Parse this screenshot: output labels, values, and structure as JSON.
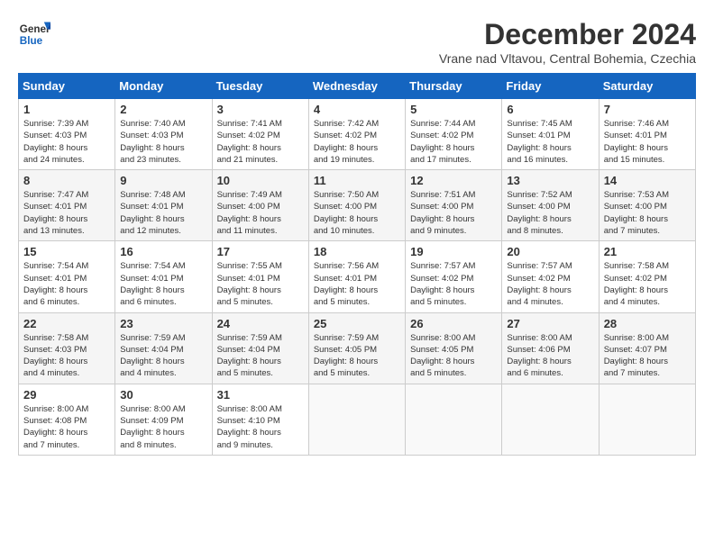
{
  "logo": {
    "line1": "General",
    "line2": "Blue"
  },
  "title": "December 2024",
  "subtitle": "Vrane nad Vltavou, Central Bohemia, Czechia",
  "days_of_week": [
    "Sunday",
    "Monday",
    "Tuesday",
    "Wednesday",
    "Thursday",
    "Friday",
    "Saturday"
  ],
  "weeks": [
    [
      {
        "day": "1",
        "info": "Sunrise: 7:39 AM\nSunset: 4:03 PM\nDaylight: 8 hours\nand 24 minutes."
      },
      {
        "day": "2",
        "info": "Sunrise: 7:40 AM\nSunset: 4:03 PM\nDaylight: 8 hours\nand 23 minutes."
      },
      {
        "day": "3",
        "info": "Sunrise: 7:41 AM\nSunset: 4:02 PM\nDaylight: 8 hours\nand 21 minutes."
      },
      {
        "day": "4",
        "info": "Sunrise: 7:42 AM\nSunset: 4:02 PM\nDaylight: 8 hours\nand 19 minutes."
      },
      {
        "day": "5",
        "info": "Sunrise: 7:44 AM\nSunset: 4:02 PM\nDaylight: 8 hours\nand 17 minutes."
      },
      {
        "day": "6",
        "info": "Sunrise: 7:45 AM\nSunset: 4:01 PM\nDaylight: 8 hours\nand 16 minutes."
      },
      {
        "day": "7",
        "info": "Sunrise: 7:46 AM\nSunset: 4:01 PM\nDaylight: 8 hours\nand 15 minutes."
      }
    ],
    [
      {
        "day": "8",
        "info": "Sunrise: 7:47 AM\nSunset: 4:01 PM\nDaylight: 8 hours\nand 13 minutes."
      },
      {
        "day": "9",
        "info": "Sunrise: 7:48 AM\nSunset: 4:01 PM\nDaylight: 8 hours\nand 12 minutes."
      },
      {
        "day": "10",
        "info": "Sunrise: 7:49 AM\nSunset: 4:00 PM\nDaylight: 8 hours\nand 11 minutes."
      },
      {
        "day": "11",
        "info": "Sunrise: 7:50 AM\nSunset: 4:00 PM\nDaylight: 8 hours\nand 10 minutes."
      },
      {
        "day": "12",
        "info": "Sunrise: 7:51 AM\nSunset: 4:00 PM\nDaylight: 8 hours\nand 9 minutes."
      },
      {
        "day": "13",
        "info": "Sunrise: 7:52 AM\nSunset: 4:00 PM\nDaylight: 8 hours\nand 8 minutes."
      },
      {
        "day": "14",
        "info": "Sunrise: 7:53 AM\nSunset: 4:00 PM\nDaylight: 8 hours\nand 7 minutes."
      }
    ],
    [
      {
        "day": "15",
        "info": "Sunrise: 7:54 AM\nSunset: 4:01 PM\nDaylight: 8 hours\nand 6 minutes."
      },
      {
        "day": "16",
        "info": "Sunrise: 7:54 AM\nSunset: 4:01 PM\nDaylight: 8 hours\nand 6 minutes."
      },
      {
        "day": "17",
        "info": "Sunrise: 7:55 AM\nSunset: 4:01 PM\nDaylight: 8 hours\nand 5 minutes."
      },
      {
        "day": "18",
        "info": "Sunrise: 7:56 AM\nSunset: 4:01 PM\nDaylight: 8 hours\nand 5 minutes."
      },
      {
        "day": "19",
        "info": "Sunrise: 7:57 AM\nSunset: 4:02 PM\nDaylight: 8 hours\nand 5 minutes."
      },
      {
        "day": "20",
        "info": "Sunrise: 7:57 AM\nSunset: 4:02 PM\nDaylight: 8 hours\nand 4 minutes."
      },
      {
        "day": "21",
        "info": "Sunrise: 7:58 AM\nSunset: 4:02 PM\nDaylight: 8 hours\nand 4 minutes."
      }
    ],
    [
      {
        "day": "22",
        "info": "Sunrise: 7:58 AM\nSunset: 4:03 PM\nDaylight: 8 hours\nand 4 minutes."
      },
      {
        "day": "23",
        "info": "Sunrise: 7:59 AM\nSunset: 4:04 PM\nDaylight: 8 hours\nand 4 minutes."
      },
      {
        "day": "24",
        "info": "Sunrise: 7:59 AM\nSunset: 4:04 PM\nDaylight: 8 hours\nand 5 minutes."
      },
      {
        "day": "25",
        "info": "Sunrise: 7:59 AM\nSunset: 4:05 PM\nDaylight: 8 hours\nand 5 minutes."
      },
      {
        "day": "26",
        "info": "Sunrise: 8:00 AM\nSunset: 4:05 PM\nDaylight: 8 hours\nand 5 minutes."
      },
      {
        "day": "27",
        "info": "Sunrise: 8:00 AM\nSunset: 4:06 PM\nDaylight: 8 hours\nand 6 minutes."
      },
      {
        "day": "28",
        "info": "Sunrise: 8:00 AM\nSunset: 4:07 PM\nDaylight: 8 hours\nand 7 minutes."
      }
    ],
    [
      {
        "day": "29",
        "info": "Sunrise: 8:00 AM\nSunset: 4:08 PM\nDaylight: 8 hours\nand 7 minutes."
      },
      {
        "day": "30",
        "info": "Sunrise: 8:00 AM\nSunset: 4:09 PM\nDaylight: 8 hours\nand 8 minutes."
      },
      {
        "day": "31",
        "info": "Sunrise: 8:00 AM\nSunset: 4:10 PM\nDaylight: 8 hours\nand 9 minutes."
      },
      {
        "day": "",
        "info": ""
      },
      {
        "day": "",
        "info": ""
      },
      {
        "day": "",
        "info": ""
      },
      {
        "day": "",
        "info": ""
      }
    ]
  ]
}
